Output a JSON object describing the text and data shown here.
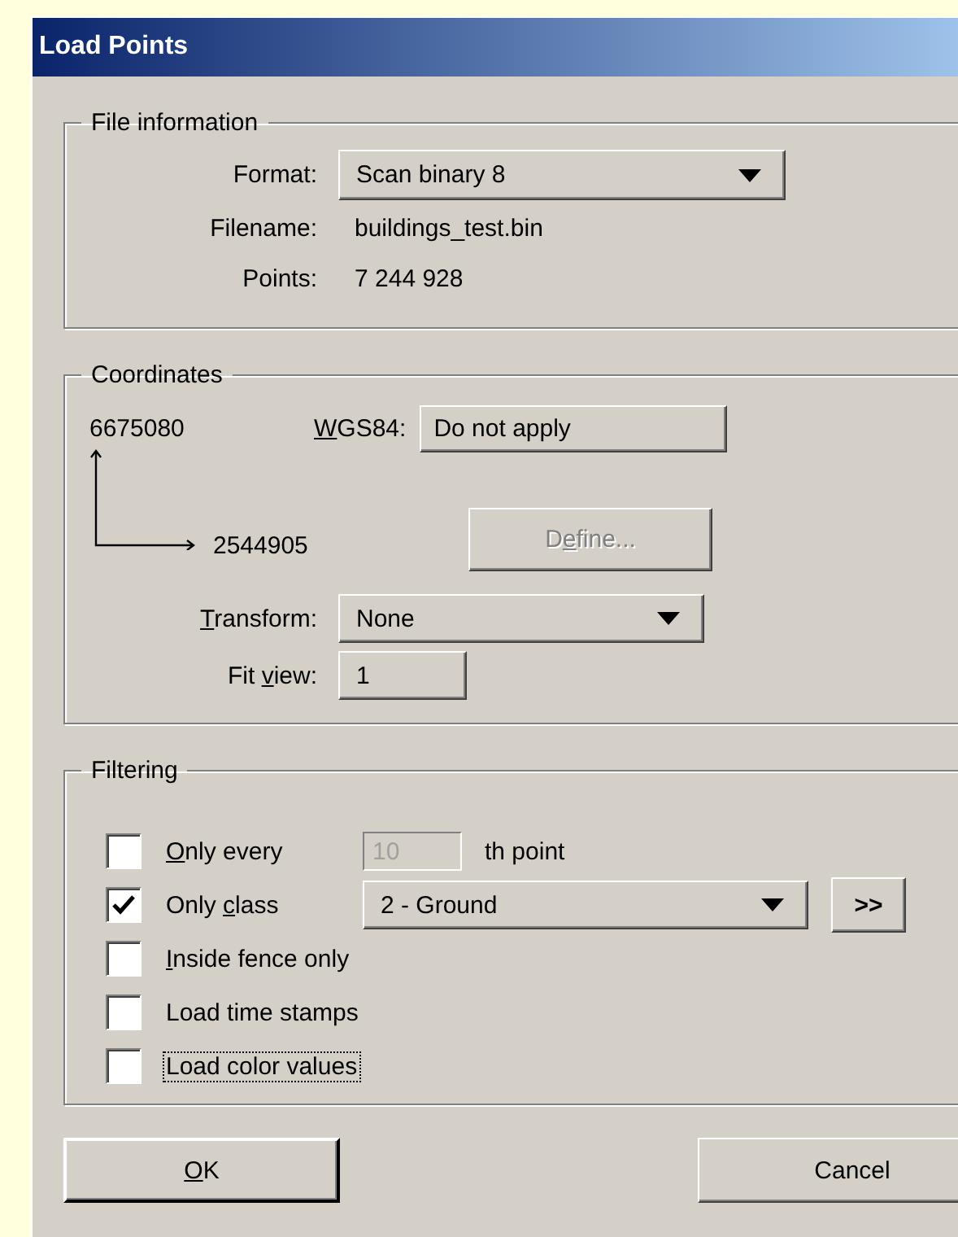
{
  "window": {
    "title": "Load Points"
  },
  "file_information": {
    "title": "File information",
    "fields": [
      {
        "kind": "dropdown",
        "label": "Format:",
        "value": "Scan binary 8"
      },
      {
        "kind": "text",
        "label": "Filename:",
        "value": "buildings_test.bin"
      },
      {
        "kind": "text",
        "label": "Points:",
        "value": "7 244 928"
      }
    ]
  },
  "coordinates": {
    "title": "Coordinates",
    "y_value": "6675080",
    "x_value": "2544905",
    "wgs84": {
      "label": {
        "key": "W",
        "post": "GS84:"
      },
      "value": "Do not apply"
    },
    "define_button": {
      "label": {
        "pre": "D",
        "key": "e",
        "post": "fine..."
      },
      "disabled": true
    },
    "fields": [
      {
        "kind": "dropdown",
        "label": {
          "key": "T",
          "post": "ransform:"
        },
        "value": "None"
      },
      {
        "kind": "input",
        "label": {
          "pre": "Fit ",
          "key": "v",
          "post": "iew:"
        },
        "value": "1"
      }
    ]
  },
  "filtering": {
    "title": "Filtering",
    "options": [
      {
        "kind": "every",
        "checked": false,
        "focused": false,
        "label": {
          "key": "O",
          "post": "nly every"
        },
        "field": {
          "value": "10",
          "disabled": true
        },
        "suffix": "th point"
      },
      {
        "kind": "class",
        "checked": true,
        "focused": false,
        "label": {
          "pre": "Only ",
          "key": "c",
          "post": "lass"
        },
        "dropdown": "2 - Ground",
        "more_button": ">>"
      },
      {
        "kind": "plain",
        "checked": false,
        "focused": false,
        "label": {
          "key": "I",
          "post": "nside fence only"
        }
      },
      {
        "kind": "plain",
        "checked": false,
        "focused": false,
        "label": {
          "pre": "Load time stamps"
        }
      },
      {
        "kind": "plain",
        "checked": false,
        "focused": true,
        "label": {
          "pre": "Load color values"
        }
      }
    ]
  },
  "buttons": [
    {
      "label": {
        "key": "O",
        "post": "K"
      }
    },
    {
      "label": {
        "pre": "Cancel"
      }
    }
  ]
}
